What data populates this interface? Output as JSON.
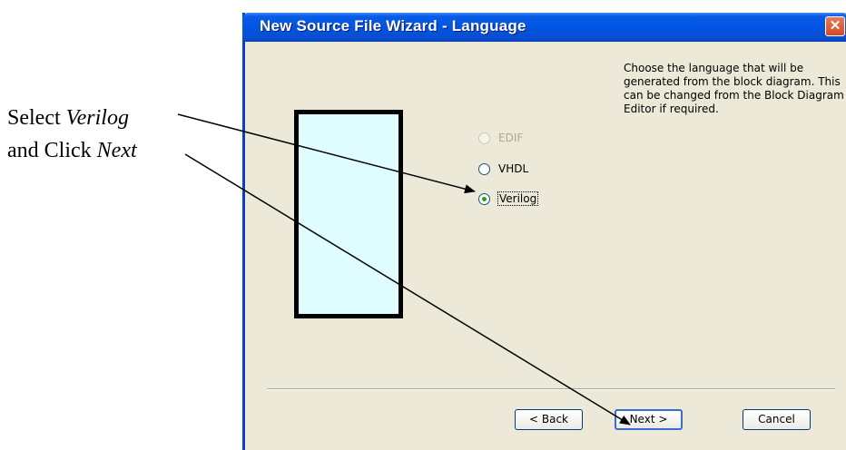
{
  "annotation": {
    "line1_prefix": "Select ",
    "line1_em": "Verilog",
    "line2_prefix": "and Click ",
    "line2_em": "Next"
  },
  "dialog": {
    "title": "New Source File Wizard - Language",
    "instruction": "Choose the language that will be generated from the block diagram. This can be changed from the Block Diagram Editor if required.",
    "options": [
      {
        "label": "EDIF",
        "state": "disabled"
      },
      {
        "label": "VHDL",
        "state": "unselected"
      },
      {
        "label": "Verilog",
        "state": "selected"
      }
    ],
    "buttons": {
      "back": "< Back",
      "next": "Next >",
      "cancel": "Cancel"
    }
  },
  "colors": {
    "titlebar": "#0054e3",
    "dialog_bg": "#ece9d8",
    "illustration_fill": "#dffcff"
  }
}
